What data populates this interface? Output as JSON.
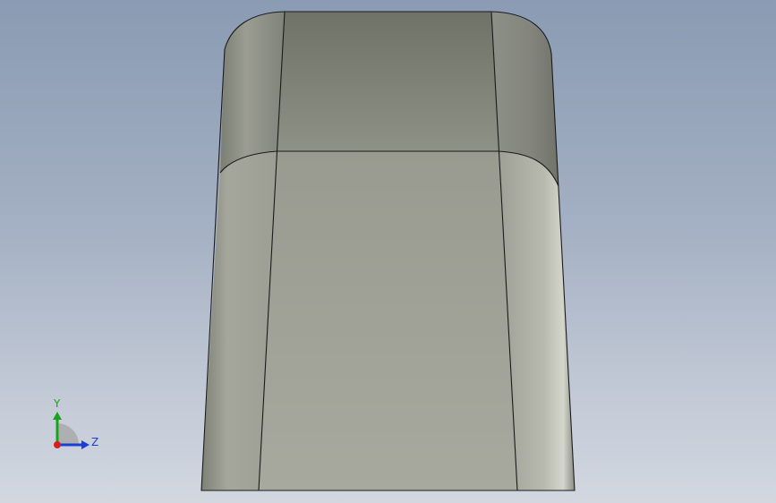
{
  "viewport": {
    "triad": {
      "x_label": "Z",
      "y_label": "Y",
      "colors": {
        "y_axis": "#1aa31a",
        "z_axis": "#1a3fd6",
        "origin": "#d81f1f",
        "arc": "#a9a9a9"
      }
    },
    "colors": {
      "background_top": "#8a9bb3",
      "background_bottom": "#d2d7e0",
      "model_face": "#a3a59a",
      "model_edge": "#1a1a1a"
    }
  }
}
